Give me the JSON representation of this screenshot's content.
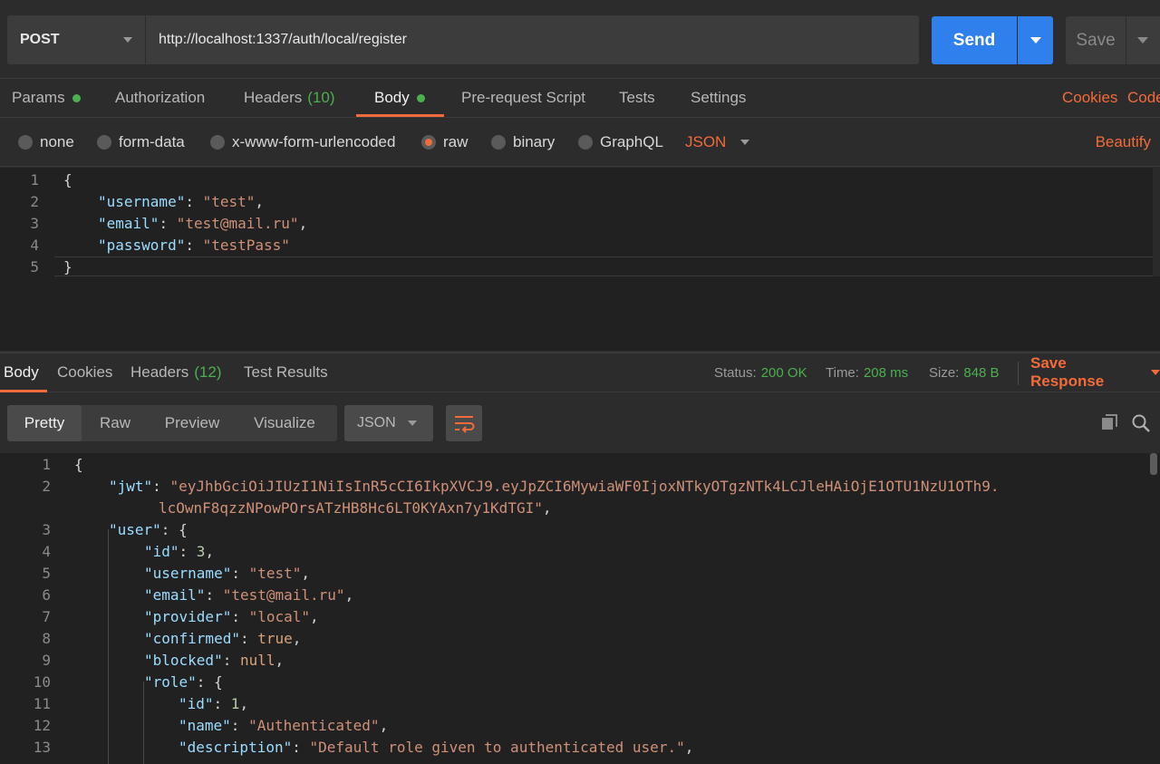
{
  "request": {
    "method": "POST",
    "url": "http://localhost:1337/auth/local/register",
    "send_label": "Send",
    "save_label": "Save"
  },
  "request_tabs": {
    "params": "Params",
    "authorization": "Authorization",
    "headers": "Headers",
    "headers_count": "(10)",
    "body": "Body",
    "prerequest": "Pre-request Script",
    "tests": "Tests",
    "settings": "Settings",
    "cookies": "Cookies",
    "code": "Code"
  },
  "body_types": {
    "none": "none",
    "form_data": "form-data",
    "urlencoded": "x-www-form-urlencoded",
    "raw": "raw",
    "binary": "binary",
    "graphql": "GraphQL",
    "format": "JSON",
    "beautify": "Beautify"
  },
  "request_body": [
    {
      "n": "1",
      "t": "{"
    },
    {
      "n": "2",
      "k": "\"username\"",
      "v": "\"test\"",
      "end": ","
    },
    {
      "n": "3",
      "k": "\"email\"",
      "v": "\"test@mail.ru\"",
      "end": ","
    },
    {
      "n": "4",
      "k": "\"password\"",
      "v": "\"testPass\"",
      "end": ""
    },
    {
      "n": "5",
      "t": "}"
    }
  ],
  "response_tabs": {
    "body": "Body",
    "cookies": "Cookies",
    "headers": "Headers",
    "headers_count": "(12)",
    "test_results": "Test Results"
  },
  "response_meta": {
    "status_label": "Status:",
    "status": "200 OK",
    "time_label": "Time:",
    "time": "208 ms",
    "size_label": "Size:",
    "size": "848 B",
    "save_response": "Save Response"
  },
  "response_view": {
    "pretty": "Pretty",
    "raw": "Raw",
    "preview": "Preview",
    "visualize": "Visualize",
    "format": "JSON"
  },
  "response_lines": {
    "l1": {
      "n": "1",
      "t": "{"
    },
    "l2": {
      "n": "2",
      "k": "\"jwt\"",
      "v": "\"eyJhbGciOiJIUzI1NiIsInR5cCI6IkpXVCJ9.eyJpZCI6MywiaWF0IjoxNTkyOTgzNTk4LCJleHAiOjE1OTU1NzU1OTh9."
    },
    "l2b": {
      "v": "lcOwnF8qzzNPowPOrsATzHB8Hc6LT0KYAxn7y1KdTGI\"",
      "end": ","
    },
    "l3": {
      "n": "3",
      "k": "\"user\"",
      "t": "{"
    },
    "l4": {
      "n": "4",
      "k": "\"id\"",
      "v": "3",
      "end": ","
    },
    "l5": {
      "n": "5",
      "k": "\"username\"",
      "v": "\"test\"",
      "end": ","
    },
    "l6": {
      "n": "6",
      "k": "\"email\"",
      "v": "\"test@mail.ru\"",
      "end": ","
    },
    "l7": {
      "n": "7",
      "k": "\"provider\"",
      "v": "\"local\"",
      "end": ","
    },
    "l8": {
      "n": "8",
      "k": "\"confirmed\"",
      "v": "true",
      "end": ","
    },
    "l9": {
      "n": "9",
      "k": "\"blocked\"",
      "v": "null",
      "end": ","
    },
    "l10": {
      "n": "10",
      "k": "\"role\"",
      "t": "{"
    },
    "l11": {
      "n": "11",
      "k": "\"id\"",
      "v": "1",
      "end": ","
    },
    "l12": {
      "n": "12",
      "k": "\"name\"",
      "v": "\"Authenticated\"",
      "end": ","
    },
    "l13": {
      "n": "13",
      "k": "\"description\"",
      "v": "\"Default role given to authenticated user.\"",
      "end": ","
    }
  },
  "icons": {
    "method_dropdown": "chevron-down-icon",
    "send_dropdown": "chevron-down-icon",
    "wrap": "wrap-lines-icon",
    "copy": "copy-icon",
    "search": "search-icon"
  },
  "colors": {
    "accent": "#f26b3a",
    "send": "#2f80ed",
    "success": "#4caf50"
  }
}
